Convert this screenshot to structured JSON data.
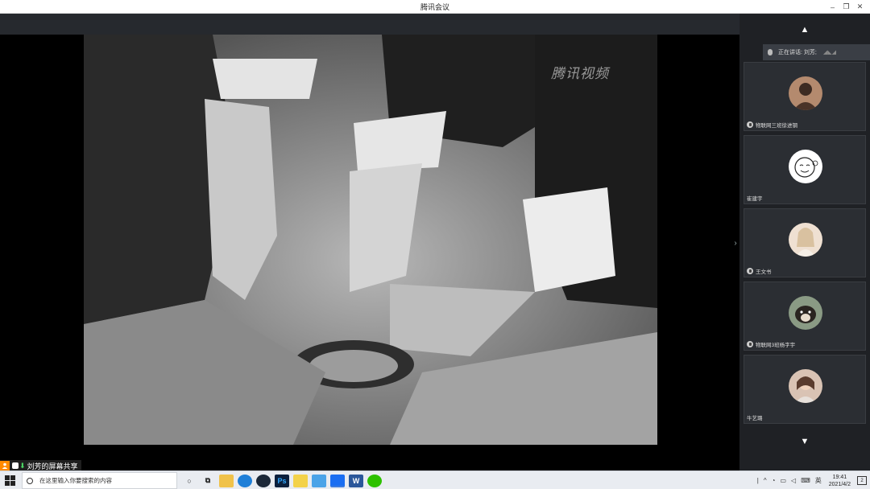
{
  "window": {
    "title": "腾讯会议",
    "controls": {
      "minimize": "–",
      "restore": "❐",
      "close": "✕"
    }
  },
  "share": {
    "watermark": "腾讯视频",
    "presenter_label": "刘芳的屏幕共享",
    "side_toggle": "›"
  },
  "panel": {
    "up_arrow": "▲",
    "down_arrow": "▼",
    "speaking_label": "正在讲话: 刘芳;",
    "speaking_wave": "◢◣◢",
    "participants": [
      {
        "name": "物联网三班徐进钢",
        "avatar": "photo-avatar",
        "muted_icon": true
      },
      {
        "name": "崔建宇",
        "avatar": "cartoon-face-avatar",
        "muted_icon": false
      },
      {
        "name": "王文书",
        "avatar": "photo-avatar",
        "muted_icon": true
      },
      {
        "name": "物联网3班杨字宇",
        "avatar": "dog-photo-avatar",
        "muted_icon": true
      },
      {
        "name": "牛艺璐",
        "avatar": "photo-avatar",
        "muted_icon": false
      }
    ]
  },
  "taskbar": {
    "search_placeholder": "在这里输入你要搜索的内容",
    "apps": [
      "cortana",
      "task-view",
      "file-explorer",
      "edge",
      "steam",
      "photoshop",
      "pen-app",
      "cloud-app",
      "tencent-meeting",
      "word",
      "wechat"
    ],
    "tray": {
      "lang": "英",
      "time": "19:41",
      "date": "2021/4/2",
      "notification_count": "2"
    }
  },
  "colors": {
    "panel_bg": "#1f2125",
    "tile_bg": "#2b2e33",
    "accent_orange": "#ff8a00",
    "taskbar_bg": "#e9ecf1"
  }
}
